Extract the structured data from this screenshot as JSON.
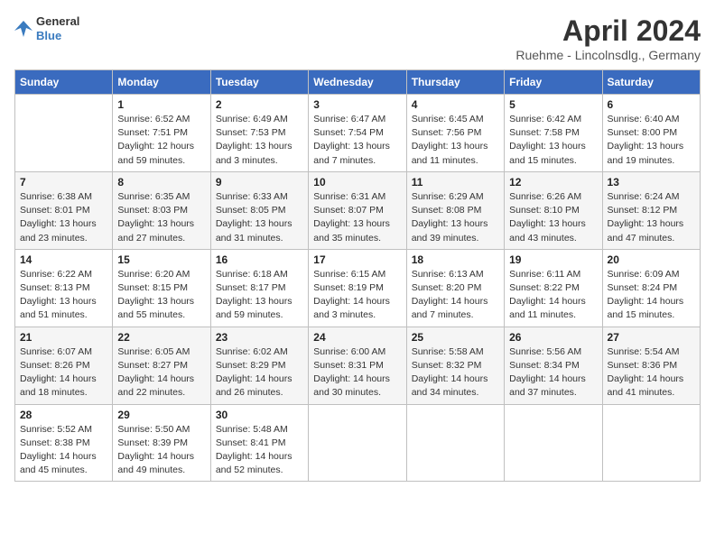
{
  "header": {
    "logo_general": "General",
    "logo_blue": "Blue",
    "title": "April 2024",
    "subtitle": "Ruehme - Lincolnsdlg., Germany"
  },
  "weekdays": [
    "Sunday",
    "Monday",
    "Tuesday",
    "Wednesday",
    "Thursday",
    "Friday",
    "Saturday"
  ],
  "weeks": [
    [
      {
        "day": "",
        "sunrise": "",
        "sunset": "",
        "daylight": ""
      },
      {
        "day": "1",
        "sunrise": "Sunrise: 6:52 AM",
        "sunset": "Sunset: 7:51 PM",
        "daylight": "Daylight: 12 hours and 59 minutes."
      },
      {
        "day": "2",
        "sunrise": "Sunrise: 6:49 AM",
        "sunset": "Sunset: 7:53 PM",
        "daylight": "Daylight: 13 hours and 3 minutes."
      },
      {
        "day": "3",
        "sunrise": "Sunrise: 6:47 AM",
        "sunset": "Sunset: 7:54 PM",
        "daylight": "Daylight: 13 hours and 7 minutes."
      },
      {
        "day": "4",
        "sunrise": "Sunrise: 6:45 AM",
        "sunset": "Sunset: 7:56 PM",
        "daylight": "Daylight: 13 hours and 11 minutes."
      },
      {
        "day": "5",
        "sunrise": "Sunrise: 6:42 AM",
        "sunset": "Sunset: 7:58 PM",
        "daylight": "Daylight: 13 hours and 15 minutes."
      },
      {
        "day": "6",
        "sunrise": "Sunrise: 6:40 AM",
        "sunset": "Sunset: 8:00 PM",
        "daylight": "Daylight: 13 hours and 19 minutes."
      }
    ],
    [
      {
        "day": "7",
        "sunrise": "Sunrise: 6:38 AM",
        "sunset": "Sunset: 8:01 PM",
        "daylight": "Daylight: 13 hours and 23 minutes."
      },
      {
        "day": "8",
        "sunrise": "Sunrise: 6:35 AM",
        "sunset": "Sunset: 8:03 PM",
        "daylight": "Daylight: 13 hours and 27 minutes."
      },
      {
        "day": "9",
        "sunrise": "Sunrise: 6:33 AM",
        "sunset": "Sunset: 8:05 PM",
        "daylight": "Daylight: 13 hours and 31 minutes."
      },
      {
        "day": "10",
        "sunrise": "Sunrise: 6:31 AM",
        "sunset": "Sunset: 8:07 PM",
        "daylight": "Daylight: 13 hours and 35 minutes."
      },
      {
        "day": "11",
        "sunrise": "Sunrise: 6:29 AM",
        "sunset": "Sunset: 8:08 PM",
        "daylight": "Daylight: 13 hours and 39 minutes."
      },
      {
        "day": "12",
        "sunrise": "Sunrise: 6:26 AM",
        "sunset": "Sunset: 8:10 PM",
        "daylight": "Daylight: 13 hours and 43 minutes."
      },
      {
        "day": "13",
        "sunrise": "Sunrise: 6:24 AM",
        "sunset": "Sunset: 8:12 PM",
        "daylight": "Daylight: 13 hours and 47 minutes."
      }
    ],
    [
      {
        "day": "14",
        "sunrise": "Sunrise: 6:22 AM",
        "sunset": "Sunset: 8:13 PM",
        "daylight": "Daylight: 13 hours and 51 minutes."
      },
      {
        "day": "15",
        "sunrise": "Sunrise: 6:20 AM",
        "sunset": "Sunset: 8:15 PM",
        "daylight": "Daylight: 13 hours and 55 minutes."
      },
      {
        "day": "16",
        "sunrise": "Sunrise: 6:18 AM",
        "sunset": "Sunset: 8:17 PM",
        "daylight": "Daylight: 13 hours and 59 minutes."
      },
      {
        "day": "17",
        "sunrise": "Sunrise: 6:15 AM",
        "sunset": "Sunset: 8:19 PM",
        "daylight": "Daylight: 14 hours and 3 minutes."
      },
      {
        "day": "18",
        "sunrise": "Sunrise: 6:13 AM",
        "sunset": "Sunset: 8:20 PM",
        "daylight": "Daylight: 14 hours and 7 minutes."
      },
      {
        "day": "19",
        "sunrise": "Sunrise: 6:11 AM",
        "sunset": "Sunset: 8:22 PM",
        "daylight": "Daylight: 14 hours and 11 minutes."
      },
      {
        "day": "20",
        "sunrise": "Sunrise: 6:09 AM",
        "sunset": "Sunset: 8:24 PM",
        "daylight": "Daylight: 14 hours and 15 minutes."
      }
    ],
    [
      {
        "day": "21",
        "sunrise": "Sunrise: 6:07 AM",
        "sunset": "Sunset: 8:26 PM",
        "daylight": "Daylight: 14 hours and 18 minutes."
      },
      {
        "day": "22",
        "sunrise": "Sunrise: 6:05 AM",
        "sunset": "Sunset: 8:27 PM",
        "daylight": "Daylight: 14 hours and 22 minutes."
      },
      {
        "day": "23",
        "sunrise": "Sunrise: 6:02 AM",
        "sunset": "Sunset: 8:29 PM",
        "daylight": "Daylight: 14 hours and 26 minutes."
      },
      {
        "day": "24",
        "sunrise": "Sunrise: 6:00 AM",
        "sunset": "Sunset: 8:31 PM",
        "daylight": "Daylight: 14 hours and 30 minutes."
      },
      {
        "day": "25",
        "sunrise": "Sunrise: 5:58 AM",
        "sunset": "Sunset: 8:32 PM",
        "daylight": "Daylight: 14 hours and 34 minutes."
      },
      {
        "day": "26",
        "sunrise": "Sunrise: 5:56 AM",
        "sunset": "Sunset: 8:34 PM",
        "daylight": "Daylight: 14 hours and 37 minutes."
      },
      {
        "day": "27",
        "sunrise": "Sunrise: 5:54 AM",
        "sunset": "Sunset: 8:36 PM",
        "daylight": "Daylight: 14 hours and 41 minutes."
      }
    ],
    [
      {
        "day": "28",
        "sunrise": "Sunrise: 5:52 AM",
        "sunset": "Sunset: 8:38 PM",
        "daylight": "Daylight: 14 hours and 45 minutes."
      },
      {
        "day": "29",
        "sunrise": "Sunrise: 5:50 AM",
        "sunset": "Sunset: 8:39 PM",
        "daylight": "Daylight: 14 hours and 49 minutes."
      },
      {
        "day": "30",
        "sunrise": "Sunrise: 5:48 AM",
        "sunset": "Sunset: 8:41 PM",
        "daylight": "Daylight: 14 hours and 52 minutes."
      },
      {
        "day": "",
        "sunrise": "",
        "sunset": "",
        "daylight": ""
      },
      {
        "day": "",
        "sunrise": "",
        "sunset": "",
        "daylight": ""
      },
      {
        "day": "",
        "sunrise": "",
        "sunset": "",
        "daylight": ""
      },
      {
        "day": "",
        "sunrise": "",
        "sunset": "",
        "daylight": ""
      }
    ]
  ]
}
